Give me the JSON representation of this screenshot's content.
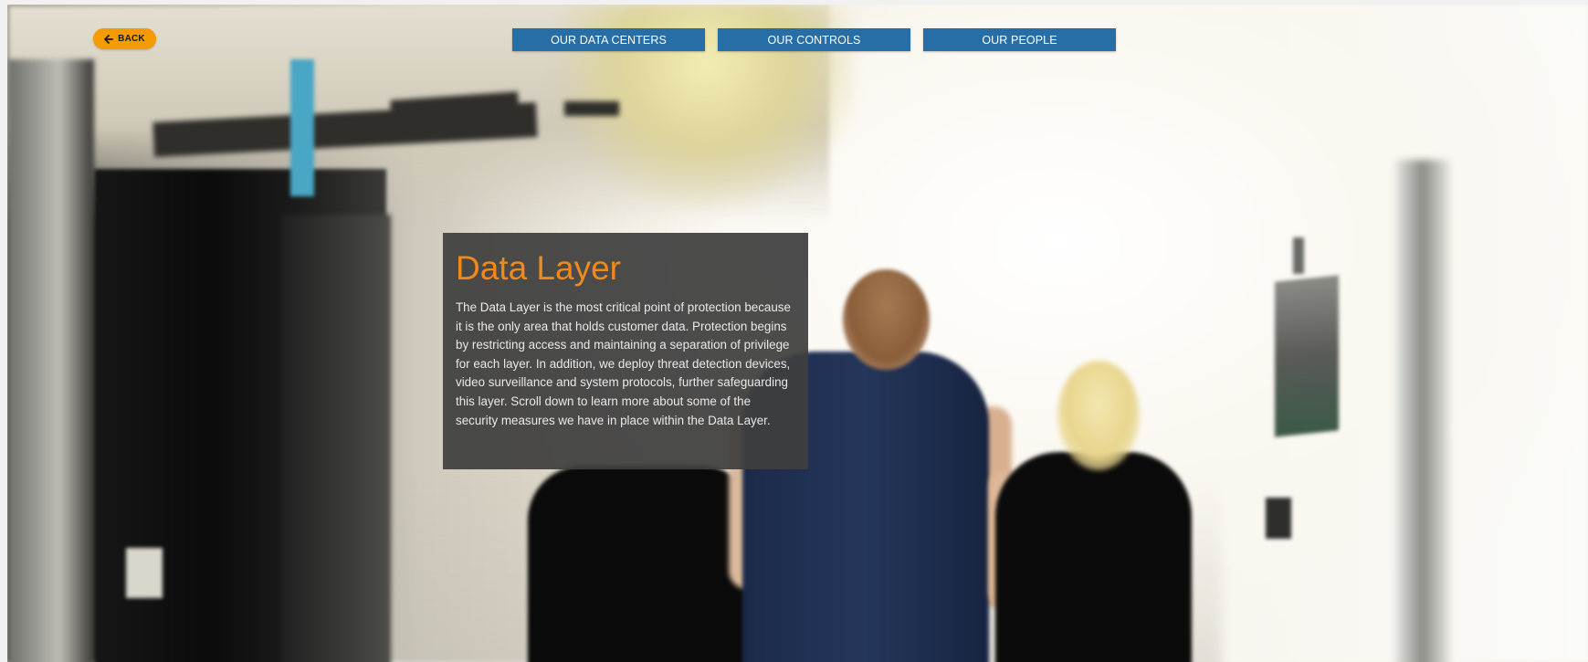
{
  "header": {
    "back_label": "BACK",
    "back_icon": "arrow-left-icon",
    "accent_color": "#f59b00"
  },
  "nav": {
    "tabs": [
      {
        "label": "OUR DATA CENTERS"
      },
      {
        "label": "OUR CONTROLS"
      },
      {
        "label": "OUR PEOPLE"
      }
    ],
    "tab_color": "#286ea6"
  },
  "panel": {
    "title": "Data Layer",
    "title_color": "#f08a1c",
    "body": "The Data Layer is the most critical point of protection because it is the only area that holds customer data. Protection begins by restricting access and maintaining a separation of privilege for each layer. In addition, we deploy threat detection devices, video surveillance and system protocols, further safeguarding this layer. Scroll down to learn more about some of the security measures we have in place within the Data Layer."
  }
}
